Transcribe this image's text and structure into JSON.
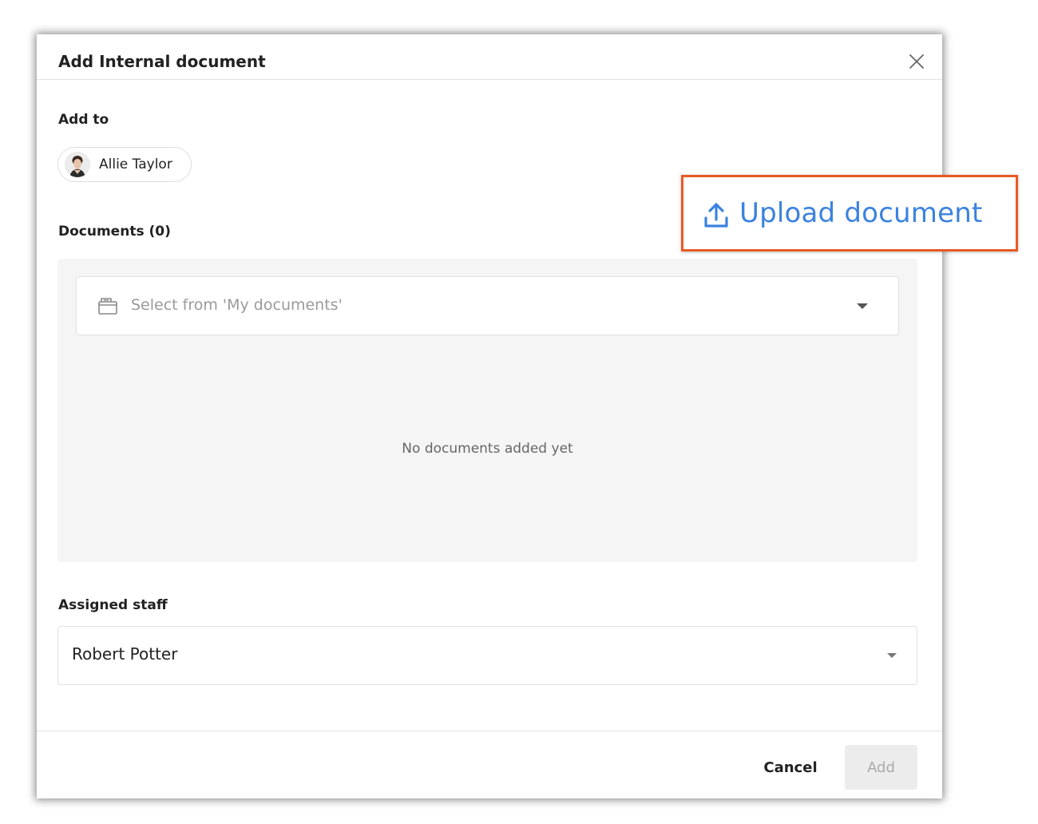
{
  "dialog": {
    "title": "Add Internal document",
    "add_to": {
      "label": "Add to",
      "recipient": "Allie Taylor"
    },
    "documents": {
      "label": "Documents (0)",
      "select_placeholder": "Select from 'My documents'",
      "empty_text": "No documents added yet"
    },
    "assigned_staff": {
      "label": "Assigned staff",
      "value": "Robert Potter"
    },
    "footer": {
      "cancel_label": "Cancel",
      "add_label": "Add"
    }
  },
  "callout": {
    "upload_label": "Upload document",
    "highlight_color": "#e85a24",
    "link_color": "#3b82e0"
  }
}
